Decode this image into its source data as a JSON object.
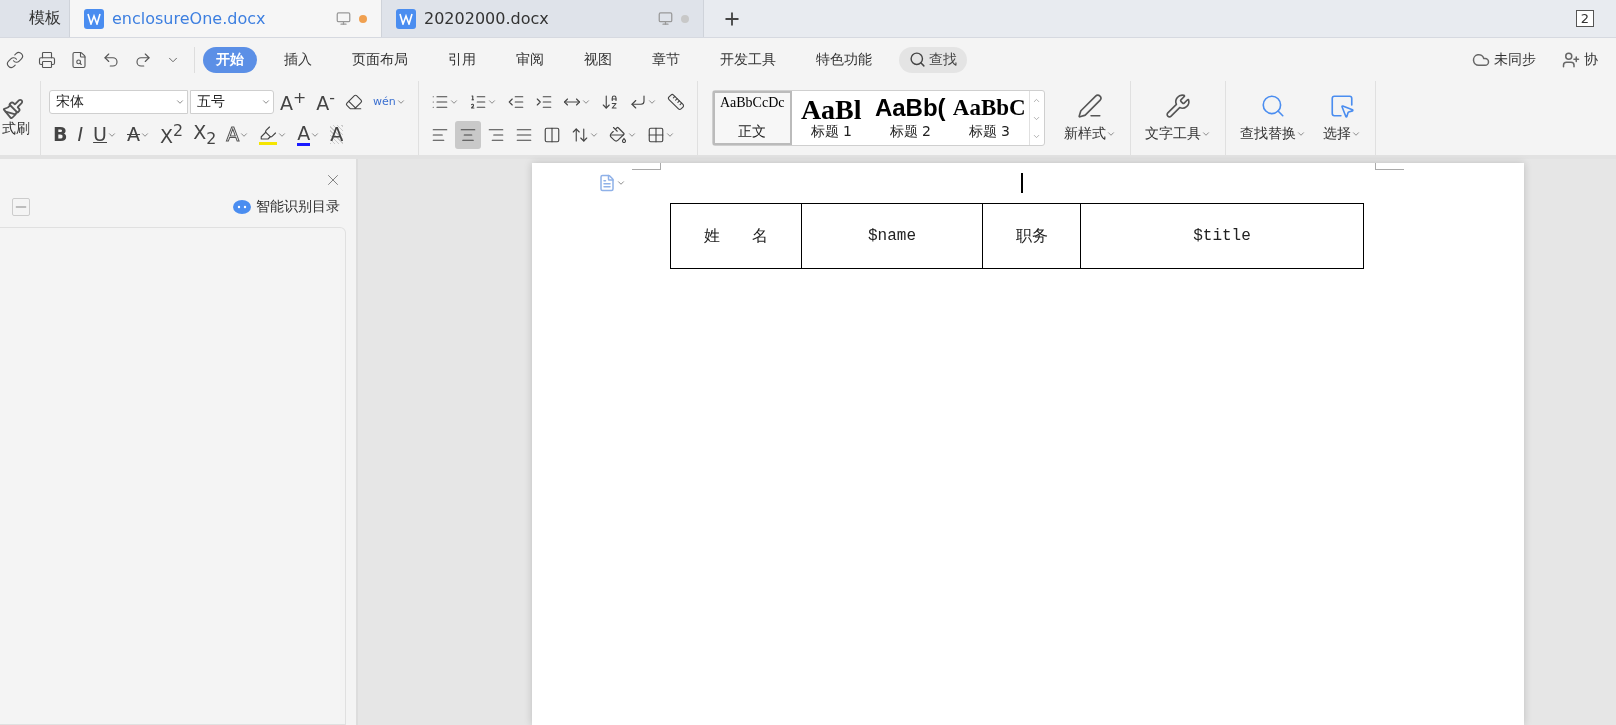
{
  "tabs": [
    {
      "label": "模板",
      "selected": false
    },
    {
      "label": "enclosureOne.docx",
      "selected": true,
      "modified": true
    },
    {
      "label": "20202000.docx",
      "selected": false,
      "modified": false
    }
  ],
  "window_count": "2",
  "menu": [
    {
      "label": "开始",
      "selected": true
    },
    {
      "label": "插入",
      "selected": false
    },
    {
      "label": "页面布局",
      "selected": false
    },
    {
      "label": "引用",
      "selected": false
    },
    {
      "label": "审阅",
      "selected": false
    },
    {
      "label": "视图",
      "selected": false
    },
    {
      "label": "章节",
      "selected": false
    },
    {
      "label": "开发工具",
      "selected": false
    },
    {
      "label": "特色功能",
      "selected": false
    }
  ],
  "search_button": "查找",
  "sync": {
    "label": "未同步"
  },
  "collab": {
    "label": "协"
  },
  "ribbon": {
    "format_painter": "式刷",
    "font": {
      "face": "宋体",
      "size": "五号"
    },
    "glyphs": {
      "grow": "A$^{+}$",
      "shrink": "A$^{-}$",
      "pinyin": "wén",
      "bold": "B",
      "italic": "I",
      "underline": "U",
      "strike": "A",
      "sup": "X$^{2}$",
      "sub": "X$_{2}$",
      "effect": "A",
      "font_color": "A",
      "shade": "A"
    },
    "alignment": [
      {
        "selected": false
      },
      {
        "selected": true
      },
      {
        "selected": false
      },
      {
        "selected": false
      },
      {
        "selected": false
      }
    ],
    "styles": [
      {
        "preview": "AaBbCcDc",
        "label": "正文",
        "kind": "body",
        "selected": true
      },
      {
        "preview": "AaBl",
        "label": "标题 1",
        "kind": "h1",
        "selected": false
      },
      {
        "preview": "AaBb(",
        "label": "标题 2",
        "kind": "h2",
        "selected": false
      },
      {
        "preview": "AaBbC",
        "label": "标题 3",
        "kind": "h3",
        "selected": false
      }
    ],
    "tools": [
      {
        "label": "新样式"
      },
      {
        "label": "文字工具"
      },
      {
        "label": "查找替换"
      },
      {
        "label": "选择"
      }
    ]
  },
  "nav_panel": {
    "smart_toc": "智能识别目录"
  },
  "document": {
    "table": [
      [
        "姓　　名",
        "$name",
        "职务",
        "$title"
      ]
    ]
  }
}
